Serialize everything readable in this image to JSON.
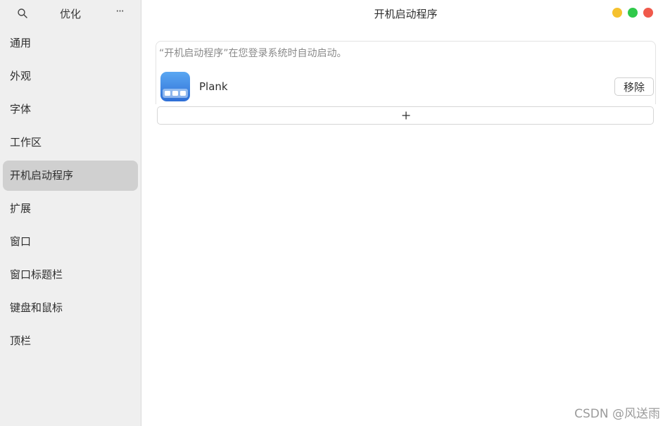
{
  "sidebar": {
    "title": "优化",
    "more": "···",
    "items": [
      {
        "label": "通用"
      },
      {
        "label": "外观"
      },
      {
        "label": "字体"
      },
      {
        "label": "工作区"
      },
      {
        "label": "开机启动程序"
      },
      {
        "label": "扩展"
      },
      {
        "label": "窗口"
      },
      {
        "label": "窗口标题栏"
      },
      {
        "label": "键盘和鼠标"
      },
      {
        "label": "顶栏"
      }
    ],
    "active_index": 4
  },
  "main": {
    "title": "开机启动程序",
    "description": "“开机启动程序”在您登录系统时自动启动。",
    "apps": [
      {
        "name": "Plank",
        "icon": "plank-icon",
        "remove_label": "移除"
      }
    ],
    "add_icon": "plus-icon"
  },
  "window_controls": [
    {
      "name": "minimize",
      "color": "#f5c12e"
    },
    {
      "name": "maximize",
      "color": "#2fc94a"
    },
    {
      "name": "close",
      "color": "#f0594b"
    }
  ],
  "watermark": "CSDN @风送雨",
  "colors": {
    "sidebar_bg": "#efefef",
    "active_item_bg": "#d0d0d0",
    "plank_icon_top": "#5aa7f2",
    "plank_icon_bottom": "#2f6fd6"
  }
}
